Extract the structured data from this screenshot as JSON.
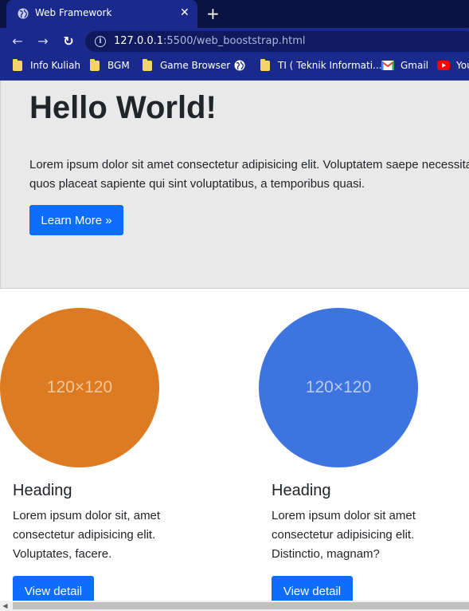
{
  "browser": {
    "tab_title": "Web Framework",
    "tab_close": "✕",
    "new_tab": "+",
    "back": "←",
    "forward": "→",
    "reload": "↻",
    "info": "i",
    "url_host": "127.0.0.1",
    "url_path": ":5500/web_booststrap.html",
    "bookmarks": [
      {
        "label": "Info Kuliah",
        "icon": "folder-icon"
      },
      {
        "label": "BGM",
        "icon": "folder-icon"
      },
      {
        "label": "Game Browser",
        "icon": "folder-icon"
      },
      {
        "label": "",
        "icon": "globe-icon"
      },
      {
        "label": "TI ( Teknik Informati...",
        "icon": "folder-icon"
      },
      {
        "label": "Gmail",
        "icon": "gmail-icon"
      },
      {
        "label": "You",
        "icon": "youtube-icon"
      }
    ]
  },
  "jumbotron": {
    "title": "Hello World!",
    "text": "Lorem ipsum dolor sit amet consectetur adipisicing elit. Voluptatem saepe necessitatibus quos placeat sapiente qui sint voluptatibus, a temporibus quasi.",
    "button": "Learn More »"
  },
  "cards": [
    {
      "placeholder": "120×120",
      "color": "#dc7b22",
      "heading": "Heading",
      "text": "Lorem ipsum dolor sit, amet consectetur adipisicing elit. Voluptates, facere.",
      "button": "View detail"
    },
    {
      "placeholder": "120×120",
      "color": "#3e74e0",
      "heading": "Heading",
      "text": "Lorem ipsum dolor sit amet consectetur adipisicing elit. Distinctio, magnam?",
      "button": "View detail"
    }
  ],
  "colors": {
    "browser_frame": "#1a2a8c",
    "primary_button": "#0d6efd",
    "jumbotron_bg": "#e9e9e9"
  }
}
